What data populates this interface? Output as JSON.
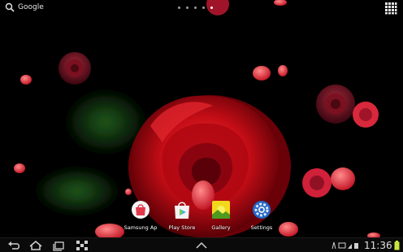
{
  "topbar": {
    "search_label": "Google"
  },
  "dock": {
    "apps": [
      {
        "label": "Samsung Ap",
        "icon": "samsung-apps-icon"
      },
      {
        "label": "Play Store",
        "icon": "play-store-icon"
      },
      {
        "label": "Gallery",
        "icon": "gallery-icon"
      },
      {
        "label": "Settings",
        "icon": "settings-icon"
      }
    ]
  },
  "statusbar": {
    "time": "11:36"
  },
  "colors": {
    "rose": "#d41420",
    "leaf": "#0f3a10",
    "background": "#000000"
  }
}
